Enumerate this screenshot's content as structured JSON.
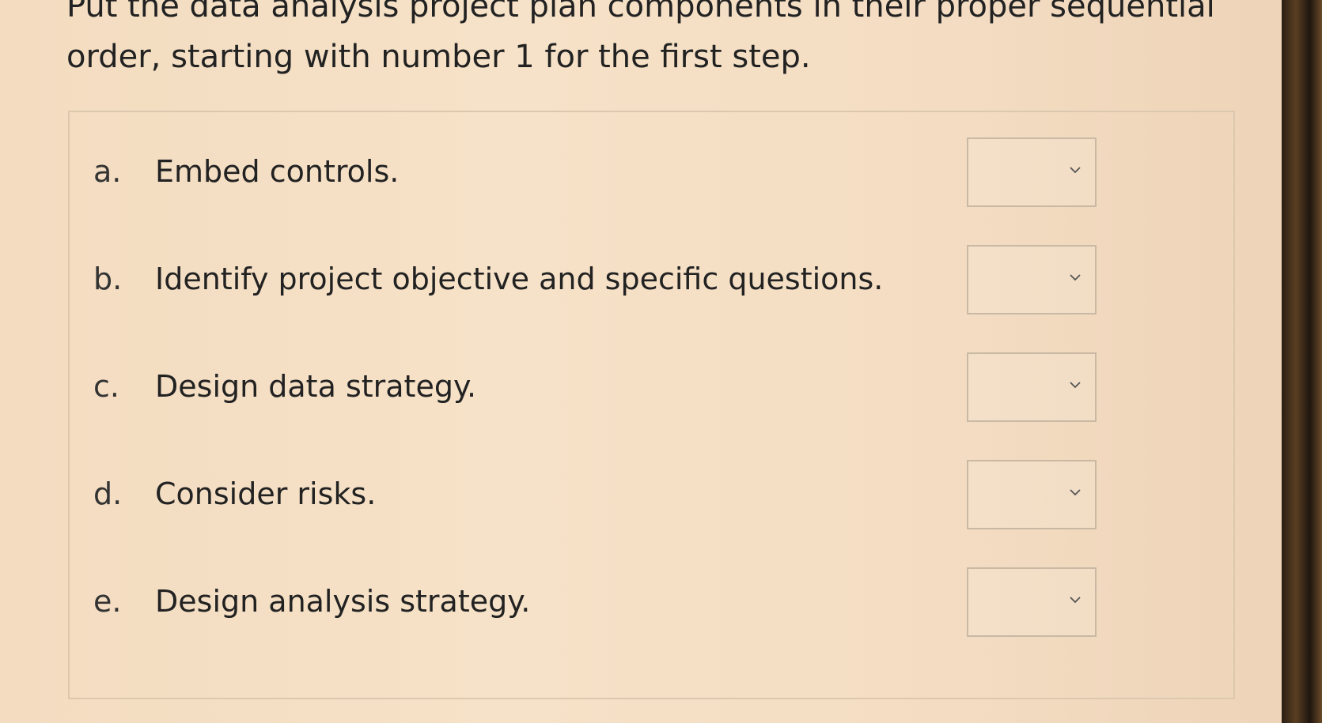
{
  "question": {
    "line1": "Put the data analysis project plan components in their proper sequential",
    "line2": "order, starting with number 1 for the first step."
  },
  "items": [
    {
      "letter": "a.",
      "text": "Embed controls.",
      "selected": ""
    },
    {
      "letter": "b.",
      "text": "Identify project objective and specific questions.",
      "selected": ""
    },
    {
      "letter": "c.",
      "text": "Design data strategy.",
      "selected": ""
    },
    {
      "letter": "d.",
      "text": "Consider risks.",
      "selected": ""
    },
    {
      "letter": "e.",
      "text": "Design analysis strategy.",
      "selected": ""
    }
  ],
  "icons": {
    "dropdown": "chevron-down-icon"
  },
  "colors": {
    "background": "#f5e0c6",
    "text": "#222222",
    "border": "#c9b9a4"
  }
}
